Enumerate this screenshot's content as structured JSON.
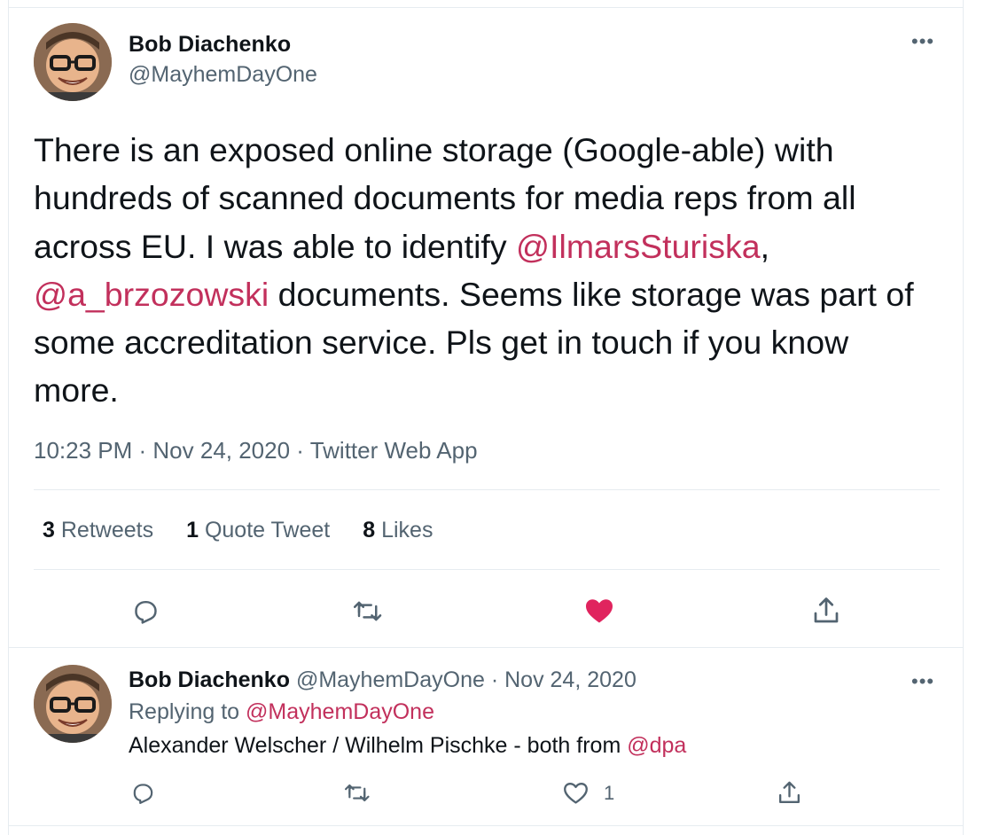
{
  "tweet": {
    "author_name": "Bob Diachenko",
    "author_handle": "@MayhemDayOne",
    "more_label": "•••",
    "text_parts": {
      "p1": "There is an exposed online storage (Google-able) with hundreds of scanned documents for media reps from all across EU. I was able to identify ",
      "m1": "@IlmarsSturiska",
      "p2": ", ",
      "m2": "@a_brzozowski",
      "p3": " documents. Seems like storage was part of some accreditation service. Pls get in touch if you know more."
    },
    "meta": "10:23 PM · Nov 24, 2020 · Twitter Web App",
    "stats": {
      "retweets_count": "3",
      "retweets_label": "Retweets",
      "quotes_count": "1",
      "quotes_label": "Quote Tweet",
      "likes_count": "8",
      "likes_label": "Likes"
    },
    "actions": [
      "reply-icon",
      "retweet-icon",
      "like-filled-icon",
      "share-icon"
    ],
    "like_color": "#e0245e"
  },
  "reply": {
    "author_name": "Bob Diachenko",
    "author_handle": "@MayhemDayOne",
    "separator": "·",
    "date": "Nov 24, 2020",
    "replying_label": "Replying to ",
    "replying_handle": "@MayhemDayOne",
    "text": "Alexander Welscher / Wilhelm Pischke - both from ",
    "text_mention": "@dpa",
    "more_label": "•••",
    "like_count": "1",
    "actions": [
      "reply-icon",
      "retweet-icon",
      "like-outline-icon",
      "share-icon"
    ]
  },
  "colors": {
    "mention": "#c2305c",
    "secondary_text": "#536471",
    "primary_text": "#0f1419"
  }
}
